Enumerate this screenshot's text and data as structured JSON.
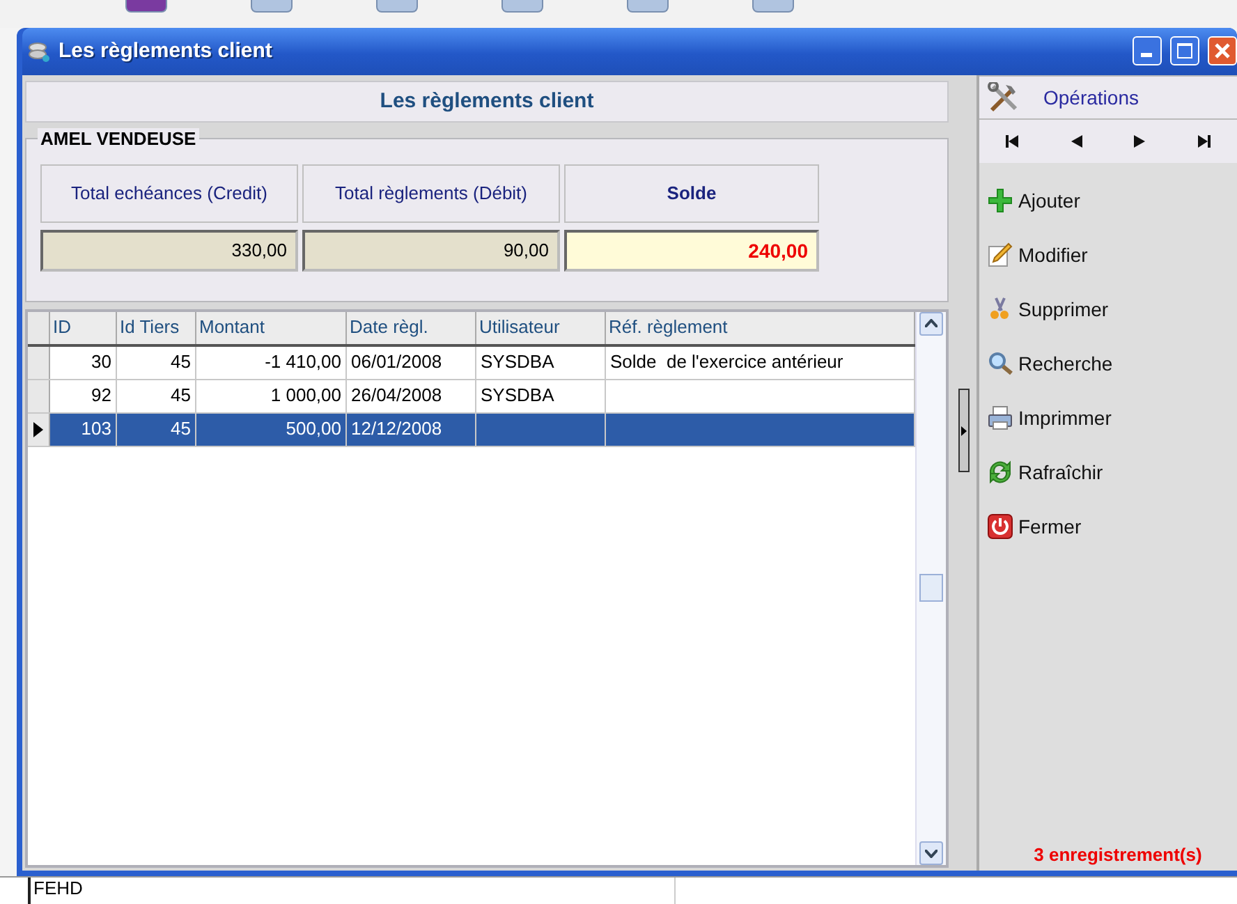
{
  "window": {
    "title": "Les règlements client"
  },
  "header": {
    "title": "Les règlements client"
  },
  "customer": {
    "name": "AMEL VENDEUSE",
    "totals": [
      {
        "label": "Total echéances (Credit)",
        "value": "330,00",
        "kind": "plain"
      },
      {
        "label": "Total règlements (Débit)",
        "value": "90,00",
        "kind": "plain"
      },
      {
        "label": "Solde",
        "value": "240,00",
        "kind": "balance"
      }
    ]
  },
  "table": {
    "columns": [
      "ID",
      "Id Tiers",
      "Montant",
      "Date règl.",
      "Utilisateur",
      "Réf. règlement"
    ],
    "rows": [
      {
        "id": "30",
        "id_tiers": "45",
        "montant": "-1 410,00",
        "date": "06/01/2008",
        "utilisateur": "SYSDBA",
        "reference": "Solde  de l'exercice antérieur",
        "selected": false
      },
      {
        "id": "92",
        "id_tiers": "45",
        "montant": "1 000,00",
        "date": "26/04/2008",
        "utilisateur": "SYSDBA",
        "selected": false
      },
      {
        "id": "103",
        "id_tiers": "45",
        "montant": "500,00",
        "date": "12/12/2008",
        "selected": true
      }
    ]
  },
  "operations": {
    "title": "Opérations",
    "actions": [
      {
        "label": "Ajouter",
        "kind": "add"
      },
      {
        "label": "Modifier",
        "kind": "edit"
      },
      {
        "label": "Supprimer",
        "kind": "delete"
      },
      {
        "label": "Recherche",
        "kind": "search"
      },
      {
        "label": "Imprimmer",
        "kind": "print"
      },
      {
        "label": "Rafraîchir",
        "kind": "refresh"
      },
      {
        "label": "Fermer",
        "kind": "close"
      }
    ],
    "record_count": "3 enregistrement(s)"
  },
  "background": {
    "cell": "FEHD"
  }
}
